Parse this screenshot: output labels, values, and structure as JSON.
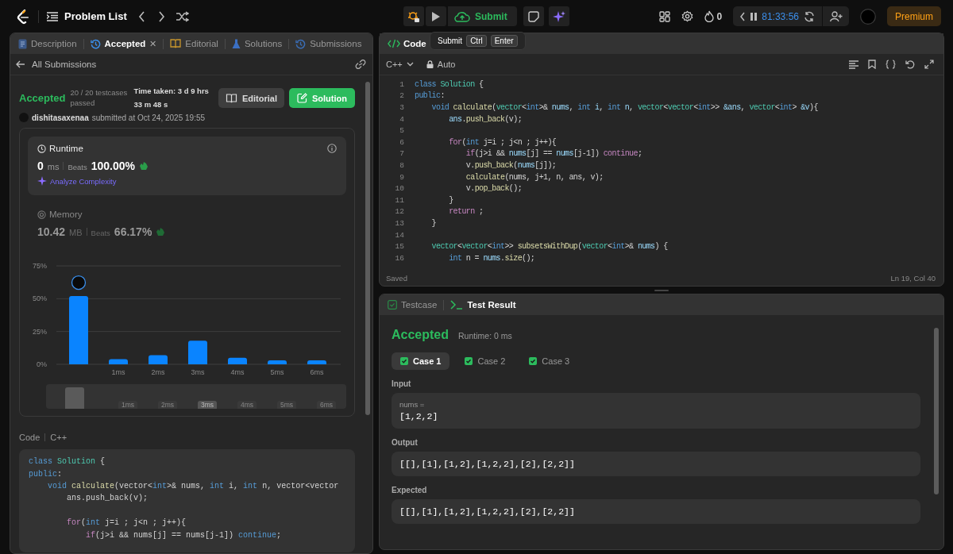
{
  "top_bar": {
    "title": "Problem List",
    "submit": "Submit",
    "streak": "0",
    "timer": "81:33:56",
    "premium": "Premium"
  },
  "tooltip": {
    "label": "Submit",
    "keys": [
      "Ctrl",
      "Enter"
    ]
  },
  "left_panel": {
    "tabs": [
      {
        "label": "Description",
        "kind": "doc",
        "selected": false
      },
      {
        "label": "Accepted",
        "kind": "history",
        "selected": true,
        "close_label": "✕"
      },
      {
        "label": "Editorial",
        "kind": "book",
        "selected": false
      },
      {
        "label": "Solutions",
        "kind": "flask",
        "selected": false
      },
      {
        "label": "Submissions",
        "kind": "history",
        "selected": false
      }
    ],
    "back_link": "All Submissions",
    "submission": {
      "status": "Accepted",
      "testcases": "20 / 20 testcases passed",
      "time_taken": "Time taken: 3 d 9 hrs 33 m 48 s",
      "user": "dishitasaxenaa",
      "submitted": "submitted at Oct 24, 2025 19:55",
      "editorial_button": "Editorial",
      "solution_button": "Solution"
    },
    "runtime": {
      "title": "Runtime",
      "value": "0",
      "unit": "ms",
      "beats_label": "Beats",
      "beats": "100.00%",
      "analyze": "Analyze Complexity"
    },
    "memory": {
      "title": "Memory",
      "value": "10.42",
      "unit": "MB",
      "beats_label": "Beats",
      "beats": "66.17%"
    },
    "chart_data": {
      "type": "bar",
      "categories": [
        null,
        "1ms",
        "2ms",
        "3ms",
        "4ms",
        "5ms",
        "6ms"
      ],
      "values": [
        52,
        4,
        7,
        18,
        5,
        3,
        3
      ],
      "ylim": [
        0,
        75
      ],
      "yticks": [
        {
          "value": 0,
          "label": "0%"
        },
        {
          "value": 25,
          "label": "25%"
        },
        {
          "value": 50,
          "label": "50%"
        },
        {
          "value": 75,
          "label": "75%"
        }
      ]
    },
    "range_labels": [
      {
        "label": "1ms",
        "highlighted": false
      },
      {
        "label": "2ms",
        "highlighted": false
      },
      {
        "label": "3ms",
        "highlighted": true
      },
      {
        "label": "4ms",
        "highlighted": false
      },
      {
        "label": "5ms",
        "highlighted": false
      },
      {
        "label": "6ms",
        "highlighted": false
      }
    ],
    "code_section": {
      "title": "Code",
      "language": "C++",
      "lines": [
        {
          "kind": "code",
          "tokens": [
            {
              "kind": "kw",
              "text": "class "
            },
            {
              "kind": "type",
              "text": "Solution"
            },
            {
              "kind": "p",
              "text": " {"
            }
          ]
        },
        {
          "kind": "code",
          "tokens": [
            {
              "kind": "kw",
              "text": "public"
            },
            {
              "kind": "p",
              "text": ":"
            }
          ]
        },
        {
          "kind": "code",
          "tokens": [
            {
              "kind": "kw",
              "text": "    void "
            },
            {
              "kind": "fn",
              "text": "calculate"
            },
            {
              "kind": "p",
              "text": "(vector<"
            },
            {
              "kind": "kw",
              "text": "int"
            },
            {
              "kind": "p",
              "text": ">& nums, "
            },
            {
              "kind": "kw",
              "text": "int"
            },
            {
              "kind": "p",
              "text": " i, "
            },
            {
              "kind": "kw",
              "text": "int"
            },
            {
              "kind": "p",
              "text": " n, vector<vector"
            }
          ]
        },
        {
          "kind": "code",
          "tokens": [
            {
              "kind": "p",
              "text": "        ans.push_back(v);"
            }
          ]
        },
        {
          "kind": "blank"
        },
        {
          "kind": "code",
          "tokens": [
            {
              "kind": "ctl",
              "text": "        for"
            },
            {
              "kind": "p",
              "text": "("
            },
            {
              "kind": "kw",
              "text": "int"
            },
            {
              "kind": "p",
              "text": " j=i ; j<n ; j++){"
            }
          ]
        },
        {
          "kind": "code",
          "tokens": [
            {
              "kind": "ctl",
              "text": "            if"
            },
            {
              "kind": "p",
              "text": "(j>i && nums[j] == nums[j-1]) "
            },
            {
              "kind": "kw",
              "text": "continue"
            },
            {
              "kind": "p",
              "text": ";"
            }
          ]
        }
      ]
    }
  },
  "editor": {
    "tab": "Code",
    "language": "C++",
    "mode": "Auto",
    "status": "Saved",
    "cursor": "Ln 19, Col 40",
    "lines": [
      {
        "number": "1",
        "kind": "code",
        "tokens": [
          {
            "kind": "kw",
            "text": "class "
          },
          {
            "kind": "type",
            "text": "Solution"
          },
          {
            "kind": "p",
            "text": " {"
          }
        ]
      },
      {
        "number": "2",
        "kind": "code",
        "tokens": [
          {
            "kind": "kw",
            "text": "public"
          },
          {
            "kind": "p",
            "text": ":"
          }
        ]
      },
      {
        "number": "3",
        "kind": "code",
        "tokens": [
          {
            "kind": "kw",
            "text": "    void "
          },
          {
            "kind": "fn",
            "text": "calculate"
          },
          {
            "kind": "p",
            "text": "("
          },
          {
            "kind": "type",
            "text": "vector"
          },
          {
            "kind": "p",
            "text": "<"
          },
          {
            "kind": "kw",
            "text": "int"
          },
          {
            "kind": "p",
            "text": ">& "
          },
          {
            "kind": "var",
            "text": "nums"
          },
          {
            "kind": "p",
            "text": ", "
          },
          {
            "kind": "kw",
            "text": "int "
          },
          {
            "kind": "var",
            "text": "i"
          },
          {
            "kind": "p",
            "text": ", "
          },
          {
            "kind": "kw",
            "text": "int "
          },
          {
            "kind": "var",
            "text": "n"
          },
          {
            "kind": "p",
            "text": ", "
          },
          {
            "kind": "type",
            "text": "vector"
          },
          {
            "kind": "p",
            "text": "<"
          },
          {
            "kind": "type",
            "text": "vector"
          },
          {
            "kind": "p",
            "text": "<"
          },
          {
            "kind": "kw",
            "text": "int"
          },
          {
            "kind": "p",
            "text": ">> "
          },
          {
            "kind": "var",
            "text": "&ans"
          },
          {
            "kind": "p",
            "text": ", "
          },
          {
            "kind": "type",
            "text": "vector"
          },
          {
            "kind": "p",
            "text": "<"
          },
          {
            "kind": "kw",
            "text": "int"
          },
          {
            "kind": "p",
            "text": "> "
          },
          {
            "kind": "var",
            "text": "&v"
          },
          {
            "kind": "p",
            "text": "){"
          }
        ]
      },
      {
        "number": "4",
        "kind": "code",
        "tokens": [
          {
            "kind": "var",
            "text": "        ans"
          },
          {
            "kind": "p",
            "text": "."
          },
          {
            "kind": "fn",
            "text": "push_back"
          },
          {
            "kind": "p",
            "text": "(v);"
          }
        ]
      },
      {
        "number": "5",
        "kind": "blank"
      },
      {
        "number": "6",
        "kind": "code",
        "tokens": [
          {
            "kind": "ctl",
            "text": "        for"
          },
          {
            "kind": "p",
            "text": "("
          },
          {
            "kind": "kw",
            "text": "int "
          },
          {
            "kind": "p",
            "text": "j=i ; j<n ; j++){"
          }
        ]
      },
      {
        "number": "7",
        "kind": "code",
        "tokens": [
          {
            "kind": "ctl",
            "text": "            if"
          },
          {
            "kind": "p",
            "text": "(j>i && "
          },
          {
            "kind": "var",
            "text": "nums"
          },
          {
            "kind": "p",
            "text": "[j] == "
          },
          {
            "kind": "var",
            "text": "nums"
          },
          {
            "kind": "p",
            "text": "[j-1]) "
          },
          {
            "kind": "ctl",
            "text": "continue"
          },
          {
            "kind": "p",
            "text": ";"
          }
        ]
      },
      {
        "number": "8",
        "kind": "code",
        "tokens": [
          {
            "kind": "p",
            "text": "            v."
          },
          {
            "kind": "fn",
            "text": "push_back"
          },
          {
            "kind": "p",
            "text": "("
          },
          {
            "kind": "var",
            "text": "nums"
          },
          {
            "kind": "p",
            "text": "[j]);"
          }
        ]
      },
      {
        "number": "9",
        "kind": "code",
        "tokens": [
          {
            "kind": "fn",
            "text": "            calculate"
          },
          {
            "kind": "p",
            "text": "(nums, j+1, n, ans, v);"
          }
        ]
      },
      {
        "number": "10",
        "kind": "code",
        "tokens": [
          {
            "kind": "p",
            "text": "            v."
          },
          {
            "kind": "fn",
            "text": "pop_back"
          },
          {
            "kind": "p",
            "text": "();"
          }
        ]
      },
      {
        "number": "11",
        "kind": "code",
        "tokens": [
          {
            "kind": "p",
            "text": "        }"
          }
        ]
      },
      {
        "number": "12",
        "kind": "code",
        "tokens": [
          {
            "kind": "ctl",
            "text": "        return"
          },
          {
            "kind": "p",
            "text": " ;"
          }
        ]
      },
      {
        "number": "13",
        "kind": "code",
        "tokens": [
          {
            "kind": "p",
            "text": "    }"
          }
        ]
      },
      {
        "number": "14",
        "kind": "blank"
      },
      {
        "number": "15",
        "kind": "code",
        "tokens": [
          {
            "kind": "type",
            "text": "    vector"
          },
          {
            "kind": "p",
            "text": "<"
          },
          {
            "kind": "type",
            "text": "vector"
          },
          {
            "kind": "p",
            "text": "<"
          },
          {
            "kind": "kw",
            "text": "int"
          },
          {
            "kind": "p",
            "text": ">> "
          },
          {
            "kind": "fn",
            "text": "subsetsWithDup"
          },
          {
            "kind": "p",
            "text": "("
          },
          {
            "kind": "type",
            "text": "vector"
          },
          {
            "kind": "p",
            "text": "<"
          },
          {
            "kind": "kw",
            "text": "int"
          },
          {
            "kind": "p",
            "text": ">& "
          },
          {
            "kind": "var",
            "text": "nums"
          },
          {
            "kind": "p",
            "text": ") {"
          }
        ]
      },
      {
        "number": "16",
        "kind": "code",
        "tokens": [
          {
            "kind": "kw",
            "text": "        int "
          },
          {
            "kind": "p",
            "text": "n = "
          },
          {
            "kind": "var",
            "text": "nums"
          },
          {
            "kind": "p",
            "text": "."
          },
          {
            "kind": "fn",
            "text": "size"
          },
          {
            "kind": "p",
            "text": "();"
          }
        ]
      }
    ]
  },
  "test_panel": {
    "tabs": [
      {
        "label": "Testcase",
        "kind": "check",
        "selected": false
      },
      {
        "label": "Test Result",
        "kind": "terminal",
        "selected": true
      }
    ],
    "status": "Accepted",
    "runtime": "Runtime: 0 ms",
    "cases": [
      {
        "label": "Case 1",
        "selected": true,
        "passed": true
      },
      {
        "label": "Case 2",
        "selected": false,
        "passed": true
      },
      {
        "label": "Case 3",
        "selected": false,
        "passed": true
      }
    ],
    "sections": [
      {
        "label": "Input",
        "param": "nums =",
        "value": "[1,2,2]"
      },
      {
        "label": "Output",
        "value": "[[],[1],[1,2],[1,2,2],[2],[2,2]]"
      },
      {
        "label": "Expected",
        "value": "[[],[1],[1,2],[1,2,2],[2],[2,2]]"
      }
    ]
  }
}
